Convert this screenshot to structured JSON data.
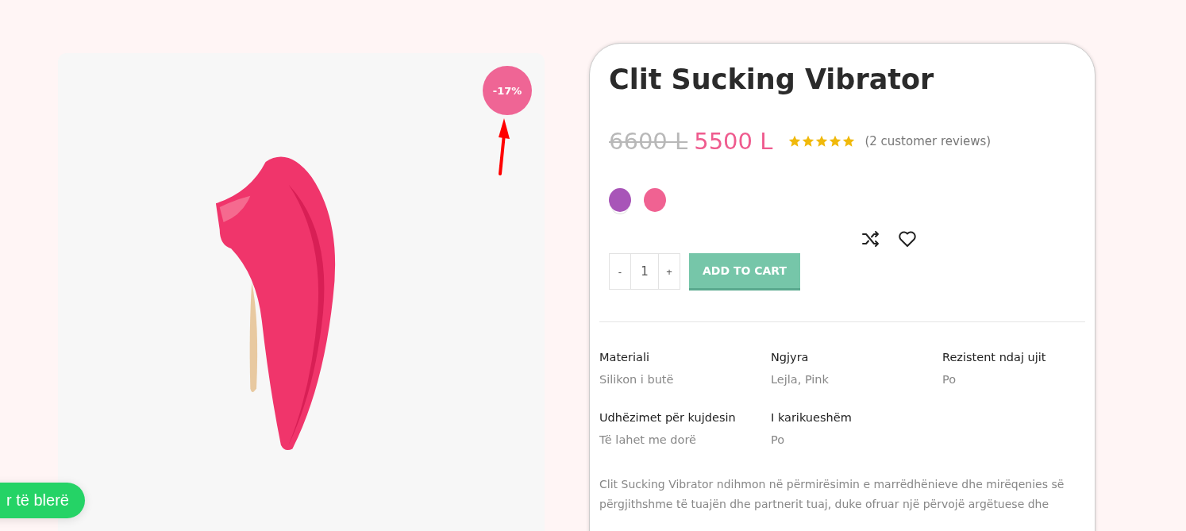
{
  "gallery": {
    "badge": "-17%"
  },
  "product": {
    "title": "Clit Sucking Vibrator",
    "old_price": "6600 L",
    "price": "5500 L",
    "stars": 5,
    "reviews": "(2 customer reviews)",
    "swatches": [
      {
        "color": "#a855b8",
        "selected": true
      },
      {
        "color": "#f06292",
        "selected": false
      }
    ],
    "quantity": {
      "minus": "-",
      "value": "1",
      "plus": "+"
    },
    "add_to_cart": "ADD TO CART",
    "attributes": [
      {
        "label": "Materiali",
        "value": "Silikon i butë"
      },
      {
        "label": "Ngjyra",
        "value": "Lejla, Pink"
      },
      {
        "label": "Rezistent ndaj ujit",
        "value": "Po"
      },
      {
        "label": "Udhëzimet për kujdesin",
        "value": "Të lahet me dorë"
      },
      {
        "label": "I karikueshëm",
        "value": "Po"
      }
    ],
    "description": "Clit Sucking Vibrator ndihmon në përmirësimin e marrëdhënieve dhe mirëqenies së përgjithshme të tuajën dhe partnerit tuaj, duke ofruar një përvojë argëtuese dhe"
  },
  "whatsapp_button": "r të blerë"
}
